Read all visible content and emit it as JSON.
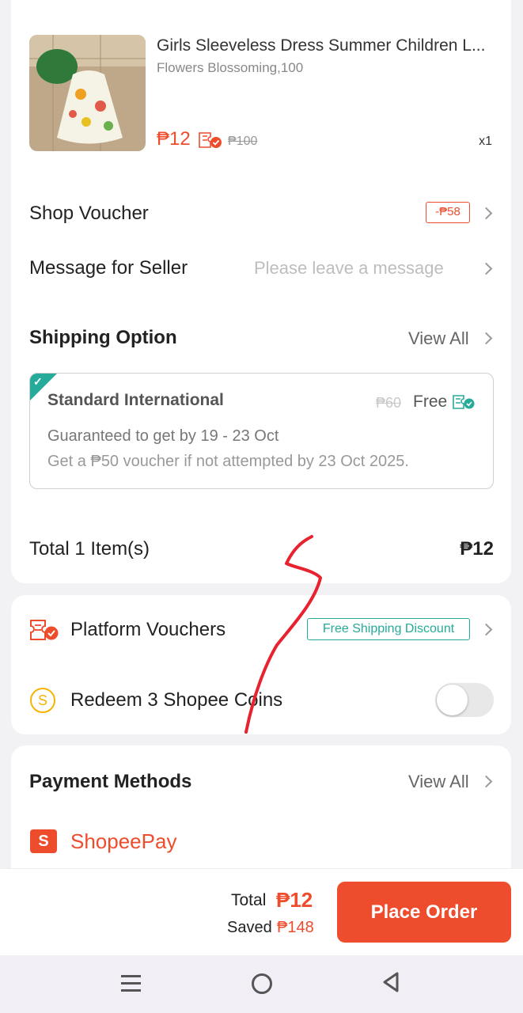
{
  "product": {
    "title": "Girls Sleeveless Dress Summer Children L...",
    "variant": "Flowers Blossoming,100",
    "price": "₱12",
    "original_price": "₱100",
    "quantity": "x1"
  },
  "shop_voucher": {
    "label": "Shop Voucher",
    "value": "-₱58"
  },
  "message": {
    "label": "Message for Seller",
    "placeholder": "Please leave a message"
  },
  "shipping": {
    "title": "Shipping Option",
    "view_all": "View All",
    "option_name": "Standard International",
    "old_fee": "₱60",
    "fee": "Free",
    "guarantee": "Guaranteed to get by 19 - 23 Oct",
    "voucher_note": "Get a ₱50 voucher if not attempted by 23 Oct 2025."
  },
  "order_total": {
    "label": "Total 1 Item(s)",
    "value": "₱12"
  },
  "platform_vouchers": {
    "label": "Platform Vouchers",
    "tag": "Free Shipping Discount"
  },
  "coins": {
    "label": "Redeem 3 Shopee Coins",
    "icon_text": "S",
    "enabled": false
  },
  "payment": {
    "title": "Payment Methods",
    "view_all": "View All",
    "method": "ShopeePay",
    "icon_text": "S"
  },
  "footer": {
    "total_label": "Total",
    "total_value": "₱12",
    "saved_label": "Saved",
    "saved_value": "₱148",
    "place_order": "Place Order"
  },
  "colors": {
    "accent": "#ee4d2d",
    "teal": "#26aa99",
    "coin": "#f6b400"
  },
  "icons": [
    "voucher-check-icon",
    "chevron-right-icon",
    "platform-voucher-icon",
    "coin-icon",
    "shopeepay-icon",
    "menu-icon",
    "home-icon",
    "back-icon"
  ]
}
